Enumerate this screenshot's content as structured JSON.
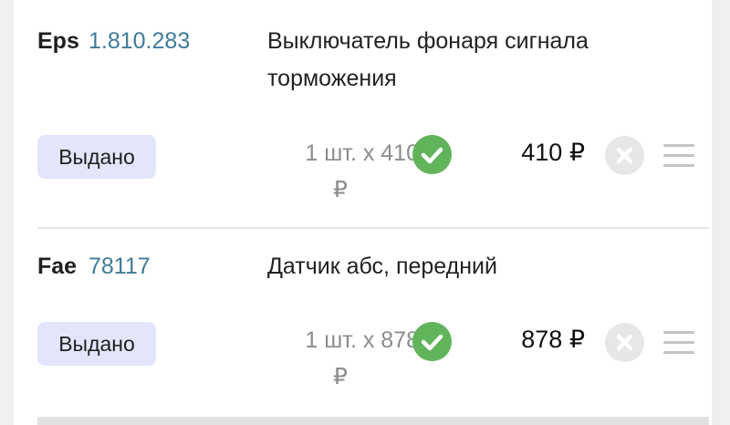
{
  "items": [
    {
      "brand": "Eps",
      "code": "1.810.283",
      "name": "Выключатель фонаря сигнала торможения",
      "status": "Выдано",
      "qty_line1": "1 шт. x 410",
      "qty_line2": "₽",
      "price": "410 ₽"
    },
    {
      "brand": "Fae",
      "code": "78117",
      "name": "Датчик абс, передний",
      "status": "Выдано",
      "qty_line1": "1 шт. x 878",
      "qty_line2": "₽",
      "price": "878 ₽"
    }
  ],
  "icons": {
    "confirm": "check-circle-icon",
    "remove": "close-circle-icon",
    "reorder": "drag-handle-icon"
  },
  "colors": {
    "code": "#3f7b98",
    "status_bg": "#e3e6fb",
    "check": "#62b45b",
    "remove": "#e7e7e7"
  }
}
